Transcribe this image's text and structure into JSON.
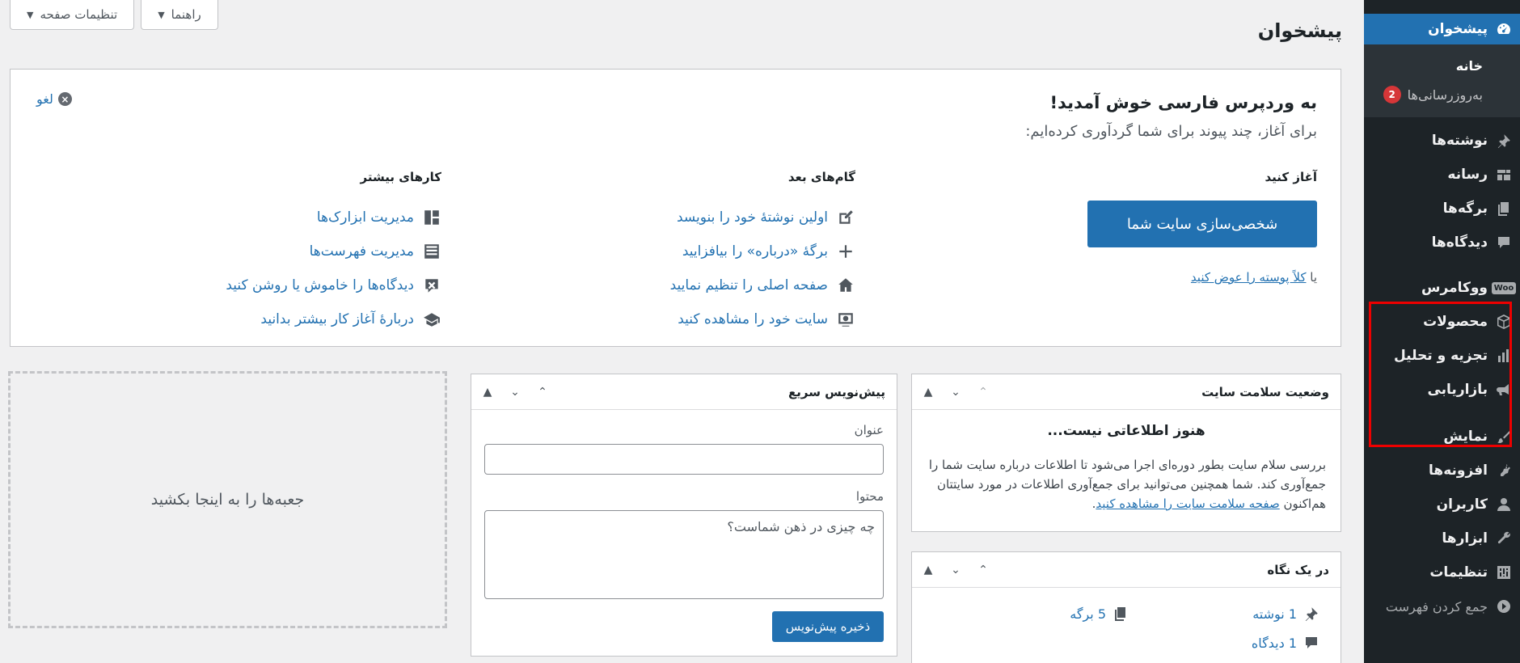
{
  "screen_options": {
    "screen_label": "تنظیمات صفحه",
    "help_label": "راهنما"
  },
  "page_title": "پیشخوان",
  "sidebar": {
    "dashboard": "پیشخوان",
    "home": "خانه",
    "updates": "به‌روزرسانی‌ها",
    "updates_count": "2",
    "posts": "نوشته‌ها",
    "media": "رسانه",
    "pages": "برگه‌ها",
    "comments": "دیدگاه‌ها",
    "woocommerce": "ووکامرس",
    "woo_icon": "Woo",
    "products": "محصولات",
    "analytics": "تجزیه و تحلیل",
    "marketing": "بازاریابی",
    "appearance": "نمایش",
    "plugins": "افزونه‌ها",
    "users": "کاربران",
    "tools": "ابزارها",
    "settings": "تنظیمات",
    "collapse": "جمع کردن فهرست"
  },
  "welcome": {
    "title": "به وردپرس فارسی خوش آمدید!",
    "about": "برای آغاز، چند پیوند برای شما گردآوری کرده‌ایم:",
    "dismiss": "لغو",
    "get_started": "آغاز کنید",
    "customize_btn": "شخصی‌سازی سایت شما",
    "or_text": "یا",
    "change_theme_link": "کلاً پوسته را عوض کنید",
    "next_steps_title": "گام‌های بعد",
    "next_steps": [
      "اولین نوشتهٔ خود را بنویسد",
      "برگهٔ «درباره» را بیافزایید",
      "صفحه اصلی را تنظیم نمایید",
      "سایت خود را مشاهده کنید"
    ],
    "more_actions_title": "کارهای بیشتر",
    "more_actions": [
      "مدیریت ابزارک‌ها",
      "مدیریت فهرست‌ها",
      "دیدگاه‌ها را خاموش یا روشن کنید",
      "دربارهٔ آغاز کار بیشتر بدانید"
    ]
  },
  "health": {
    "title": "وضعیت سلامت سایت",
    "no_info": "هنوز اطلاعاتی نیست...",
    "text": "بررسی سلام سایت بطور دوره‌ای اجرا می‌شود تا اطلاعات درباره سایت شما را جمع‌آوری کند. شما همچنین می‌توانید برای جمع‌آوری اطلاعات در مورد سایتتان هم‌اکنون",
    "link": "صفحه سلامت سایت را مشاهده کنید",
    "end": "."
  },
  "glance": {
    "title": "در یک نگاه",
    "posts": "1 نوشته",
    "pages": "5 برگه",
    "comments": "1 دیدگاه"
  },
  "quickdraft": {
    "title": "پیش‌نویس سریع",
    "title_label": "عنوان",
    "content_label": "محتوا",
    "content_placeholder": "چه چیزی در ذهن شماست؟",
    "save_btn": "ذخیره پیش‌نویس"
  },
  "dropzone_text": "جعبه‌ها را به اینجا بکشید"
}
